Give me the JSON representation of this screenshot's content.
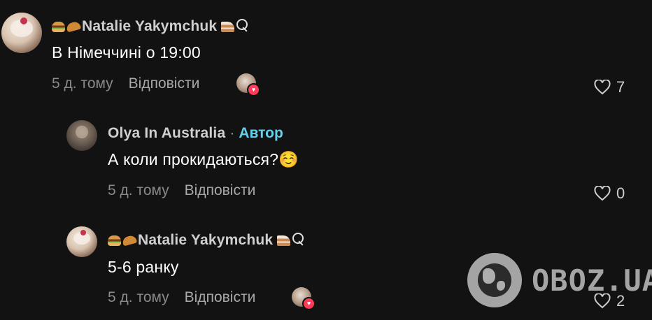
{
  "comments": [
    {
      "author": "Natalie Yakymchuk",
      "text": "В Німеччині о 19:00",
      "time": "5 д. тому",
      "reply_label": "Відповісти",
      "like_count": "7",
      "liked_by_creator": true
    },
    {
      "author": "Olya In Australia",
      "separator": "·",
      "author_badge": "Автор",
      "text": "А коли прокидаються?☺️",
      "time": "5 д. тому",
      "reply_label": "Відповісти",
      "like_count": "0",
      "liked_by_creator": false
    },
    {
      "author": "Natalie Yakymchuk",
      "text": "5-6 ранку",
      "time": "5 д. тому",
      "reply_label": "Відповісти",
      "like_count": "2",
      "liked_by_creator": true
    }
  ],
  "icons": {
    "like": "heart-outline-icon",
    "creator_like": "heart-badge-icon",
    "watermark_logo": "globe-icon"
  },
  "colors": {
    "background": "#121212",
    "author_badge": "#61d1ee",
    "heart_badge": "#ff3b5c"
  },
  "watermark": {
    "text": "OBOZ.UA"
  }
}
